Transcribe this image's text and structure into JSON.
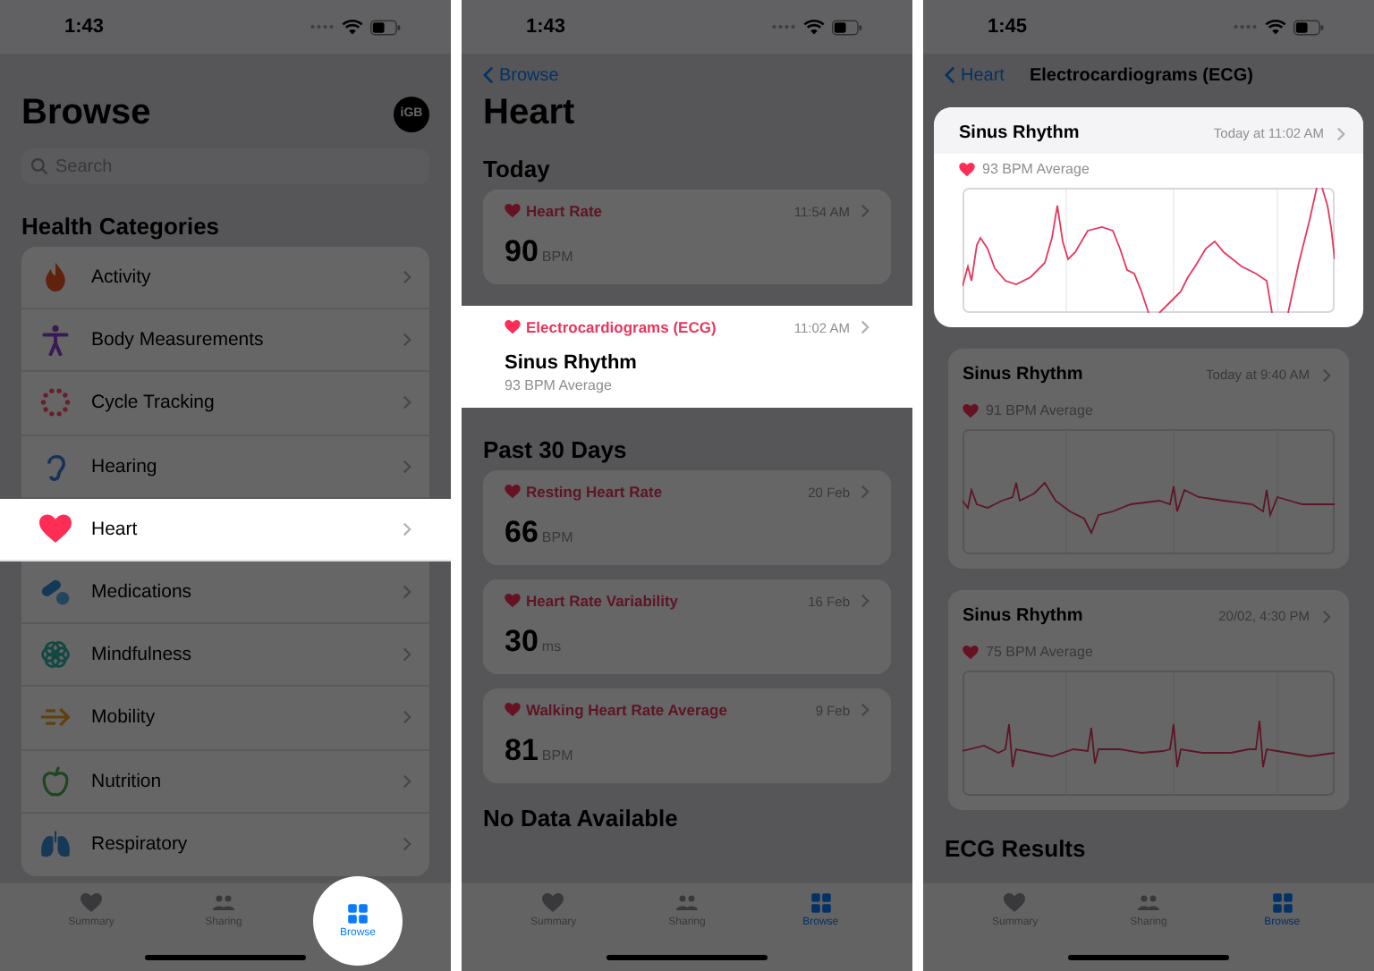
{
  "panels": [
    {
      "kind": "browse",
      "status_time": "1:43",
      "title": "Browse",
      "avatar": "iGB",
      "search": {
        "placeholder": "Search"
      },
      "section": "Health Categories",
      "categories": [
        {
          "label": "Activity",
          "highlighted": false
        },
        {
          "label": "Body Measurements",
          "highlighted": false
        },
        {
          "label": "Cycle Tracking",
          "highlighted": false
        },
        {
          "label": "Hearing",
          "highlighted": false
        },
        {
          "label": "Heart",
          "highlighted": true
        },
        {
          "label": "Medications",
          "highlighted": false
        },
        {
          "label": "Mindfulness",
          "highlighted": false
        },
        {
          "label": "Mobility",
          "highlighted": false
        },
        {
          "label": "Nutrition",
          "highlighted": false
        },
        {
          "label": "Respiratory",
          "highlighted": false
        }
      ],
      "tabs": [
        {
          "label": "Summary",
          "selected": false,
          "highlighted": false
        },
        {
          "label": "Sharing",
          "selected": false,
          "highlighted": false
        },
        {
          "label": "Browse",
          "selected": true,
          "highlighted": true
        }
      ]
    },
    {
      "kind": "detail",
      "status_time": "1:43",
      "back": "Browse",
      "title": "Heart",
      "sections": [
        {
          "heading": "Today",
          "cards": [
            {
              "kind": "metric",
              "title": "Heart Rate",
              "time": "11:54 AM",
              "value": "90",
              "unit": "BPM",
              "highlighted": false
            },
            {
              "kind": "ecg",
              "title": "Electrocardiograms (ECG)",
              "time": "11:02 AM",
              "result": "Sinus Rhythm",
              "subtitle": "93 BPM Average",
              "highlighted": true
            }
          ]
        },
        {
          "heading": "Past 30 Days",
          "cards": [
            {
              "kind": "metric",
              "title": "Resting Heart Rate",
              "time": "20 Feb",
              "value": "66",
              "unit": "BPM",
              "highlighted": false
            },
            {
              "kind": "metric",
              "title": "Heart Rate Variability",
              "time": "16 Feb",
              "value": "30",
              "unit": "ms",
              "highlighted": false
            },
            {
              "kind": "metric",
              "title": "Walking Heart Rate Average",
              "time": "9 Feb",
              "value": "81",
              "unit": "BPM",
              "highlighted": false
            }
          ]
        },
        {
          "heading": "No Data Available"
        }
      ],
      "tabs": [
        {
          "label": "Summary",
          "selected": false,
          "highlighted": false
        },
        {
          "label": "Sharing",
          "selected": false,
          "highlighted": false
        },
        {
          "label": "Browse",
          "selected": true,
          "highlighted": false
        }
      ]
    },
    {
      "kind": "ecg_list",
      "status_time": "1:45",
      "back": "Heart",
      "title": "Electrocardiograms (ECG)",
      "recordings": [
        {
          "result": "Sinus Rhythm",
          "time": "Today at 11:02 AM",
          "average": "93 BPM Average",
          "highlighted": true
        },
        {
          "result": "Sinus Rhythm",
          "time": "Today at 9:40 AM",
          "average": "91 BPM Average",
          "highlighted": false
        },
        {
          "result": "Sinus Rhythm",
          "time": "20/02, 4:30 PM",
          "average": "75 BPM Average",
          "highlighted": false
        }
      ],
      "footer_heading": "ECG Results",
      "tabs": [
        {
          "label": "Summary",
          "selected": false,
          "highlighted": false
        },
        {
          "label": "Sharing",
          "selected": false,
          "highlighted": false
        },
        {
          "label": "Browse",
          "selected": true,
          "highlighted": false
        }
      ]
    }
  ]
}
